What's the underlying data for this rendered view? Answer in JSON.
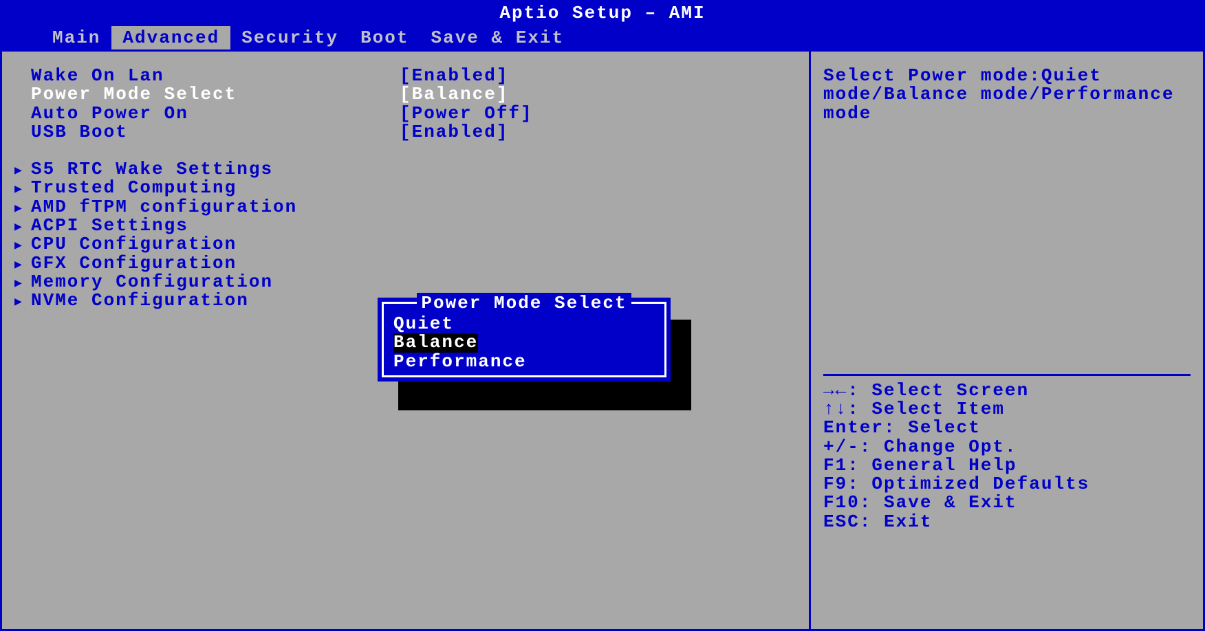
{
  "header": {
    "title": "Aptio Setup – AMI"
  },
  "tabs": [
    "Main",
    "Advanced",
    "Security",
    "Boot",
    "Save & Exit"
  ],
  "active_tab": "Advanced",
  "settings": [
    {
      "label": "Wake On Lan",
      "value": "[Enabled]",
      "selected": false
    },
    {
      "label": "Power Mode Select",
      "value": "[Balance]",
      "selected": true
    },
    {
      "label": "Auto Power On",
      "value": "[Power Off]",
      "selected": false
    },
    {
      "label": "USB Boot",
      "value": "[Enabled]",
      "selected": false
    }
  ],
  "submenus": [
    "S5 RTC Wake Settings",
    "Trusted Computing",
    "AMD fTPM configuration",
    "ACPI Settings",
    "CPU Configuration",
    "GFX Configuration",
    "Memory Configuration",
    "NVMe Configuration"
  ],
  "help": {
    "text": "Select Power mode:Quiet mode/Balance mode/Performance mode",
    "keys": [
      "→←: Select Screen",
      "↑↓: Select Item",
      "Enter: Select",
      "+/-: Change Opt.",
      "F1: General Help",
      "F9: Optimized Defaults",
      "F10: Save & Exit",
      "ESC: Exit"
    ]
  },
  "popup": {
    "title": "Power Mode Select",
    "options": [
      "Quiet",
      "Balance",
      "Performance"
    ],
    "selected": "Balance"
  }
}
